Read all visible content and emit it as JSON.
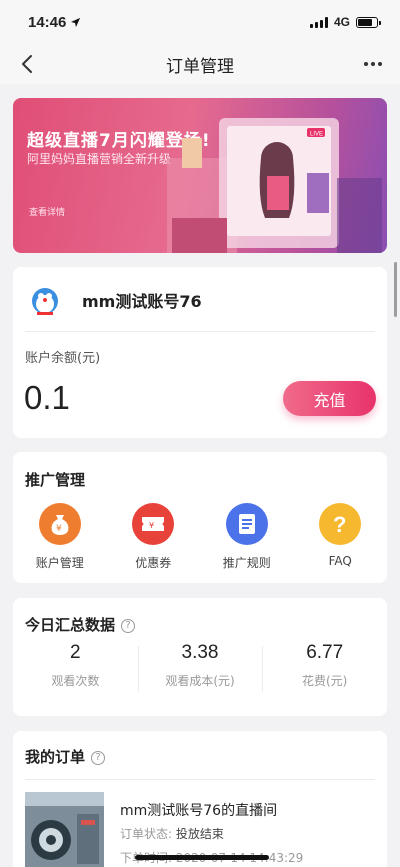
{
  "status_bar": {
    "time": "14:46",
    "network": "4G",
    "battery_level": 0.8
  },
  "nav": {
    "title": "订单管理"
  },
  "banner": {
    "title": "超级直播7月闪耀登场!",
    "subtitle": "阿里妈妈直播营销全新升级",
    "link": "查看详情",
    "badge": "LIVE"
  },
  "account": {
    "name": "mm测试账号76",
    "balance_label": "账户余额(元)",
    "balance": "0.1",
    "recharge_label": "充值"
  },
  "promotion": {
    "title": "推广管理",
    "items": [
      {
        "label": "账户管理",
        "icon": "money-bag-icon",
        "color": "#ee7d2f"
      },
      {
        "label": "优惠券",
        "icon": "coupon-icon",
        "color": "#e8433b"
      },
      {
        "label": "推广规则",
        "icon": "document-icon",
        "color": "#4b72e8"
      },
      {
        "label": "FAQ",
        "icon": "question-icon",
        "color": "#f5b82e"
      }
    ]
  },
  "today": {
    "title": "今日汇总数据",
    "stats": [
      {
        "value": "2",
        "label": "观看次数"
      },
      {
        "value": "3.38",
        "label": "观看成本(元)"
      },
      {
        "value": "6.77",
        "label": "花费(元)"
      }
    ]
  },
  "orders": {
    "title": "我的订单",
    "items": [
      {
        "title": "mm测试账号76的直播间",
        "status_label": "订单状态: ",
        "status": "投放结束",
        "time": "下单时间: 2020-07-14 14:43:29"
      }
    ]
  },
  "colors": {
    "accent": "#e8336a",
    "background": "#f2f2f4"
  }
}
